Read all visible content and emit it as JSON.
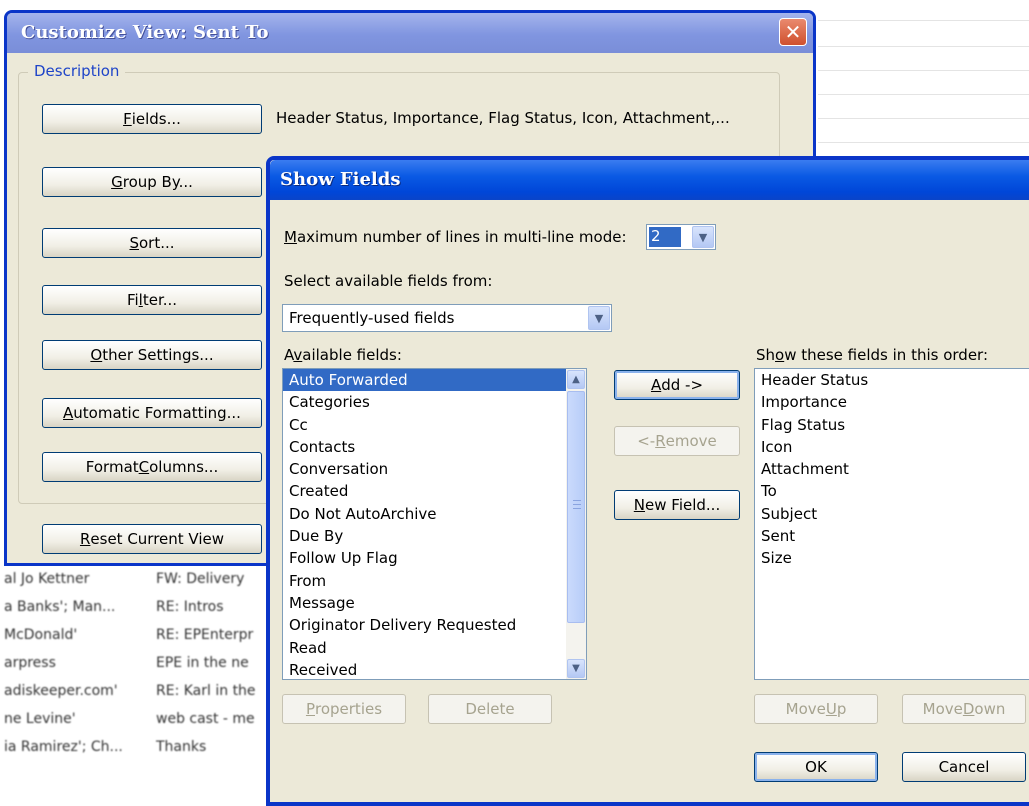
{
  "background_list": {
    "rows": [
      {
        "from": "al Jo Kettner",
        "subject": "FW: Delivery"
      },
      {
        "from": "a Banks'; Man...",
        "subject": "RE: Intros"
      },
      {
        "from": "McDonald'",
        "subject": "RE: EPEnterpr"
      },
      {
        "from": "arpress",
        "subject": "EPE in the ne"
      },
      {
        "from": "adiskeeper.com'",
        "subject": "RE: Karl in the"
      },
      {
        "from": "ne Levine'",
        "subject": "web cast - me"
      },
      {
        "from": "ia Ramirez'; Ch...",
        "subject": "Thanks"
      }
    ]
  },
  "customize_view": {
    "title": "Customize View: Sent To",
    "group_label": "Description",
    "buttons": {
      "fields": {
        "pre": "",
        "key": "F",
        "post": "ields..."
      },
      "group_by": {
        "pre": "",
        "key": "G",
        "post": "roup By..."
      },
      "sort": {
        "pre": "",
        "key": "S",
        "post": "ort..."
      },
      "filter": {
        "pre": "Fi",
        "key": "l",
        "post": "ter..."
      },
      "other_settings": {
        "pre": "",
        "key": "O",
        "post": "ther Settings..."
      },
      "automatic_formatting": {
        "pre": "",
        "key": "A",
        "post": "utomatic Formatting..."
      },
      "format_columns": {
        "pre": "Format ",
        "key": "C",
        "post": "olumns..."
      },
      "reset_current_view": {
        "pre": "",
        "key": "R",
        "post": "eset Current View"
      }
    },
    "fields_description": "Header Status, Importance, Flag Status, Icon, Attachment,..."
  },
  "show_fields": {
    "title": "Show Fields",
    "max_lines_label": {
      "pre": "",
      "key": "M",
      "post": "aximum number of lines in multi-line mode:"
    },
    "max_lines_value": "2",
    "select_from_label": {
      "pre": "Select available fields from:",
      "key": "",
      "post": ""
    },
    "select_from_value": "Frequently-used fields",
    "available_label": {
      "pre": "A",
      "key": "v",
      "post": "ailable fields:"
    },
    "available_fields": [
      "Auto Forwarded",
      "Categories",
      "Cc",
      "Contacts",
      "Conversation",
      "Created",
      "Do Not AutoArchive",
      "Due By",
      "Follow Up Flag",
      "From",
      "Message",
      "Originator Delivery Requested",
      "Read",
      "Received"
    ],
    "selected_available": "Auto Forwarded",
    "shown_label": {
      "pre": "Sh",
      "key": "o",
      "post": "w these fields in this order:"
    },
    "shown_fields": [
      "Header Status",
      "Importance",
      "Flag Status",
      "Icon",
      "Attachment",
      "To",
      "Subject",
      "Sent",
      "Size"
    ],
    "buttons": {
      "add": {
        "pre": "",
        "key": "A",
        "post": "dd ->"
      },
      "remove": {
        "pre": "<- ",
        "key": "R",
        "post": "emove"
      },
      "new_field": {
        "pre": "",
        "key": "N",
        "post": "ew Field..."
      },
      "properties": {
        "pre": "",
        "key": "P",
        "post": "roperties"
      },
      "delete": {
        "pre": "Delete",
        "key": "",
        "post": ""
      },
      "move_up": {
        "pre": "Move ",
        "key": "U",
        "post": "p"
      },
      "move_down": {
        "pre": "Move ",
        "key": "D",
        "post": "own"
      },
      "ok": {
        "pre": "OK",
        "key": "",
        "post": ""
      },
      "cancel": {
        "pre": "Cancel",
        "key": "",
        "post": ""
      }
    }
  },
  "colors": {
    "xp_blue_frame": "#0a35c8",
    "selection": "#316ac5",
    "dialog_face": "#ece9d8",
    "group_label": "#1e44c8"
  }
}
